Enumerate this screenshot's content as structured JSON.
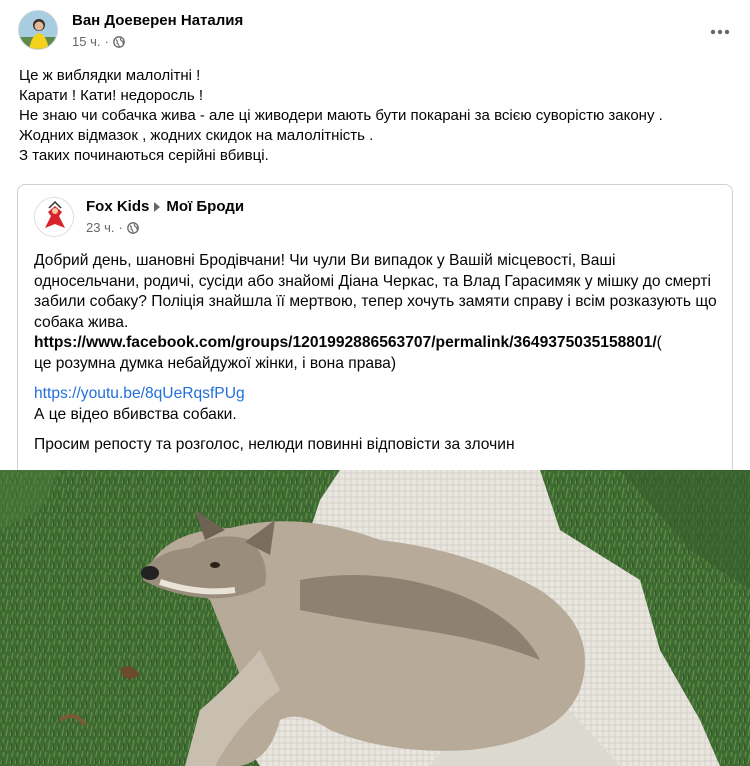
{
  "post": {
    "author": "Ван Доеверен Наталия",
    "time": "15 ч.",
    "dot": "·",
    "privacy_icon": "globe-icon",
    "more_icon": "more-dots-icon",
    "text_lines": [
      "Це ж виблядки малолітні !",
      "Карати ! Кати!  недоросль !",
      "Не знаю чи собачка жива - але ці живодери мають бути покарані за всією суворістю закону .",
      "Жодних відмазок , жодних скидок на малолітність .",
      "З таких починаються серійні вбивці."
    ]
  },
  "shared": {
    "page_name": "Fox Kids",
    "group_name": "Мої Броди",
    "time": "23 ч.",
    "dot": "·",
    "privacy_icon": "globe-icon",
    "paragraph_1": "Добрий день, шановні Бродівчани! Чи чули Ви випадок у Вашій місцевості, Ваші односельчани, родичі, сусіди або знайомі Діана Черкас, та Влад Гарасимяк у мішку до смерті забили собаку? Поліція знайшла її мертвою, тепер хочуть замяти справу і всім розказують що собака жива.",
    "link_bold": "https://www.facebook.com/groups/1201992886563707/permalink/3649375035158801/",
    "link_tail": "(",
    "note": "це розумна думка небайдужої жінки, і вона права)",
    "youtube_link": "https://youtu.be/8qUeRqsfPUg",
    "video_caption": "А це відео вбивства собаки.",
    "closing": "Просим репосту та розголос, нелюди повинні відповісти за злочин"
  },
  "colors": {
    "link_blue": "#216fdb",
    "meta_gray": "#65676b",
    "border": "#ced0d4"
  }
}
